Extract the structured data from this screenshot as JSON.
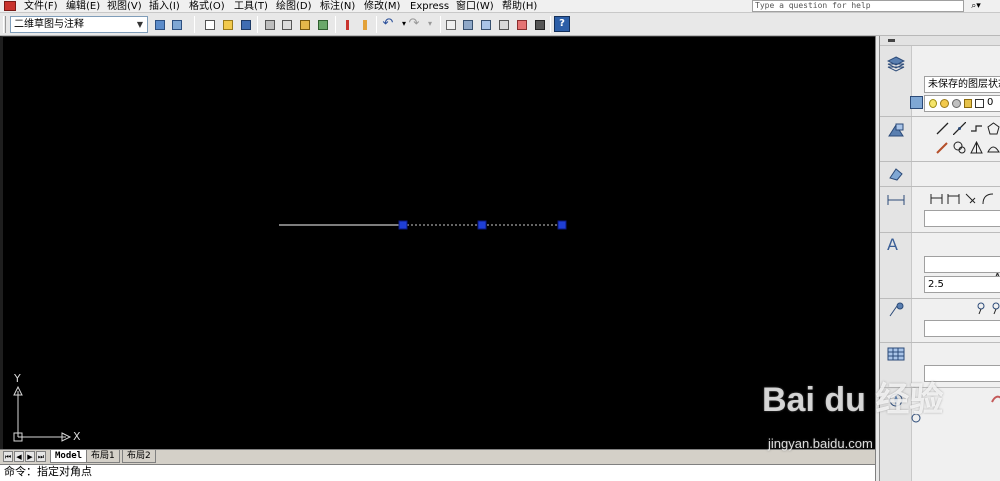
{
  "menu": {
    "items": [
      "文件(F)",
      "编辑(E)",
      "视图(V)",
      "插入(I)",
      "格式(O)",
      "工具(T)",
      "绘图(D)",
      "标注(N)",
      "修改(M)",
      "Express",
      "窗口(W)",
      "帮助(H)"
    ],
    "help_placeholder": "Type a question for help",
    "help_search_glyph": "⌕▾"
  },
  "toolbar": {
    "workspace_value": "二维草图与注释",
    "icons": [
      "workspace-settings-icon",
      "my-workspace-icon",
      "new-icon",
      "open-icon",
      "save-icon",
      "print-icon",
      "print-preview-icon",
      "publish-icon",
      "3d-dwf-icon",
      "match-properties-icon",
      "block-editor-icon",
      "undo-icon",
      "redo-icon",
      "pan-icon",
      "zoom-icon",
      "properties-icon",
      "design-center-icon",
      "tool-palettes-icon",
      "sheet-set-icon",
      "markup-icon",
      "calculator-icon",
      "help-icon"
    ]
  },
  "canvas": {
    "background": "#000000",
    "ucs_y_label": "Y",
    "ucs_x_label": "X",
    "line_color": "#c8c8c8",
    "grip_color": "#1f3fd6"
  },
  "tabs": {
    "nav": [
      "⏮",
      "◀",
      "▶",
      "⏭"
    ],
    "items": [
      {
        "label": "Model",
        "active": true
      },
      {
        "label": "布局1",
        "active": false
      },
      {
        "label": "布局2",
        "active": false
      }
    ]
  },
  "command": {
    "text": "命令：指定对角点"
  },
  "palette": {
    "layer_state": "未保存的图层状态",
    "layer_current": "0",
    "text_height": "2.5",
    "text_style_glyph": "A"
  },
  "watermark": {
    "brand": "Bai du 经验",
    "url": "jingyan.baidu.com"
  }
}
